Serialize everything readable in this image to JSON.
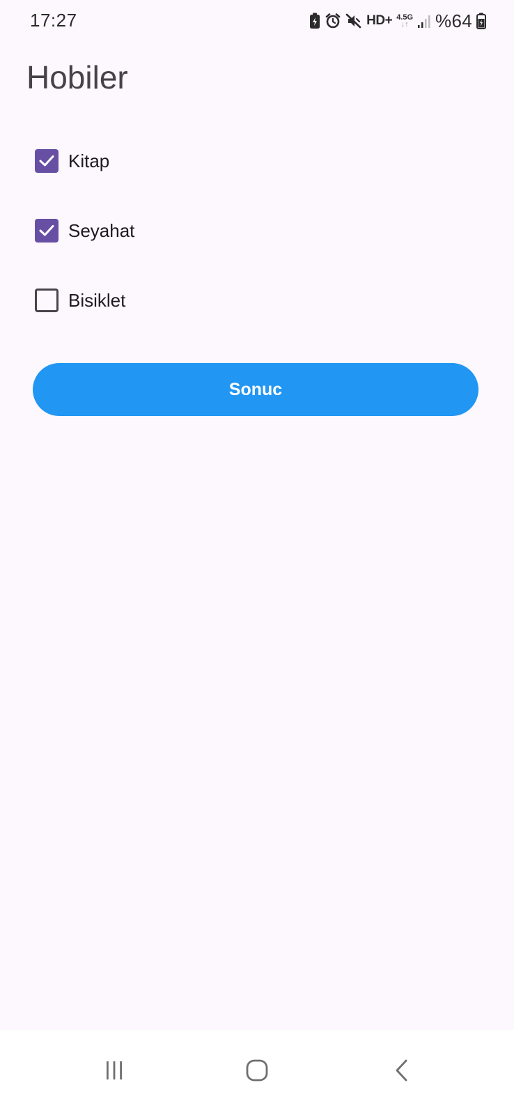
{
  "status_bar": {
    "time": "17:27",
    "network_hd": "HD+",
    "network_type": "4.5G",
    "network_arrows": "↓↑",
    "battery": "%64",
    "icons": [
      "battery-saver-icon",
      "alarm-icon",
      "mute-icon",
      "hd-voice-icon",
      "network-icon",
      "signal-icon",
      "battery-icon"
    ]
  },
  "page": {
    "title": "Hobiler"
  },
  "hobbies": [
    {
      "label": "Kitap",
      "checked": true
    },
    {
      "label": "Seyahat",
      "checked": true
    },
    {
      "label": "Bisiklet",
      "checked": false
    }
  ],
  "result_button": {
    "label": "Sonuc"
  },
  "nav_bar": {
    "icons": [
      "recent-apps-icon",
      "home-icon",
      "back-icon"
    ]
  },
  "colors": {
    "background": "#FDF7FE",
    "checkbox_checked": "#6750A4",
    "checkbox_unchecked_border": "#49454F",
    "button": "#2196F3",
    "button_text": "#FFFFFF",
    "nav_icons": "#6F6F6F"
  }
}
